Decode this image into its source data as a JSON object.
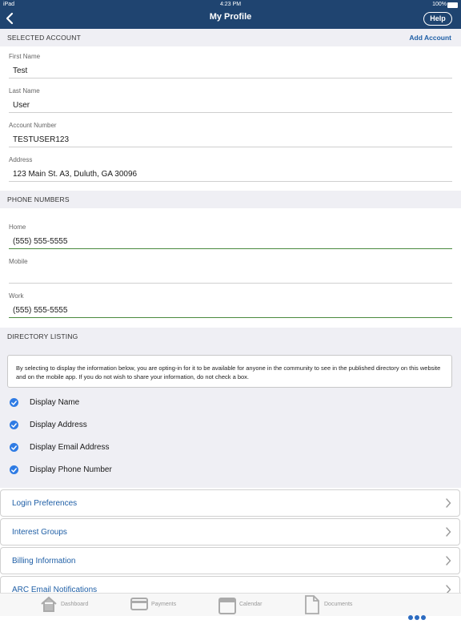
{
  "status": {
    "device": "iPad",
    "time": "4:23 PM",
    "battery": "100%"
  },
  "nav": {
    "title": "My Profile",
    "help": "Help"
  },
  "account": {
    "header": "SELECTED ACCOUNT",
    "add_label": "Add Account",
    "first_name": {
      "label": "First Name",
      "value": "Test"
    },
    "last_name": {
      "label": "Last Name",
      "value": "User"
    },
    "account_number": {
      "label": "Account Number",
      "value": "TESTUSER123"
    },
    "address": {
      "label": "Address",
      "value": "123  Main St. A3, Duluth, GA 30096"
    }
  },
  "phones": {
    "header": "PHONE NUMBERS",
    "home": {
      "label": "Home",
      "value": "(555) 555-5555"
    },
    "mobile": {
      "label": "Mobile",
      "value": ""
    },
    "work": {
      "label": "Work",
      "value": "(555) 555-5555"
    }
  },
  "directory": {
    "header": "DIRECTORY LISTING",
    "notice": "By selecting to display the information below, you are opting-in for it to be available for anyone in the community to see in the published directory on this website and on the mobile app. If you do not wish to share your information, do not check a box.",
    "options": [
      {
        "label": "Display Name",
        "checked": true
      },
      {
        "label": "Display Address",
        "checked": true
      },
      {
        "label": "Display Email Address",
        "checked": true
      },
      {
        "label": "Display Phone Number",
        "checked": true
      }
    ]
  },
  "menu_rows": [
    {
      "label": "Login Preferences"
    },
    {
      "label": "Interest Groups"
    },
    {
      "label": "Billing Information"
    },
    {
      "label": "ARC Email Notifications"
    }
  ],
  "tabs": [
    {
      "label": "Dashboard",
      "icon": "home-icon"
    },
    {
      "label": "Payments",
      "icon": "credit-card-icon"
    },
    {
      "label": "Calendar",
      "icon": "calendar-icon"
    },
    {
      "label": "Documents",
      "icon": "document-icon"
    },
    {
      "label": "",
      "icon": "more-dots-icon"
    }
  ],
  "colors": {
    "nav": "#1f4470",
    "accent": "#1f5fa6",
    "check": "#2e7be4",
    "valid_line": "#4a8a3e"
  }
}
